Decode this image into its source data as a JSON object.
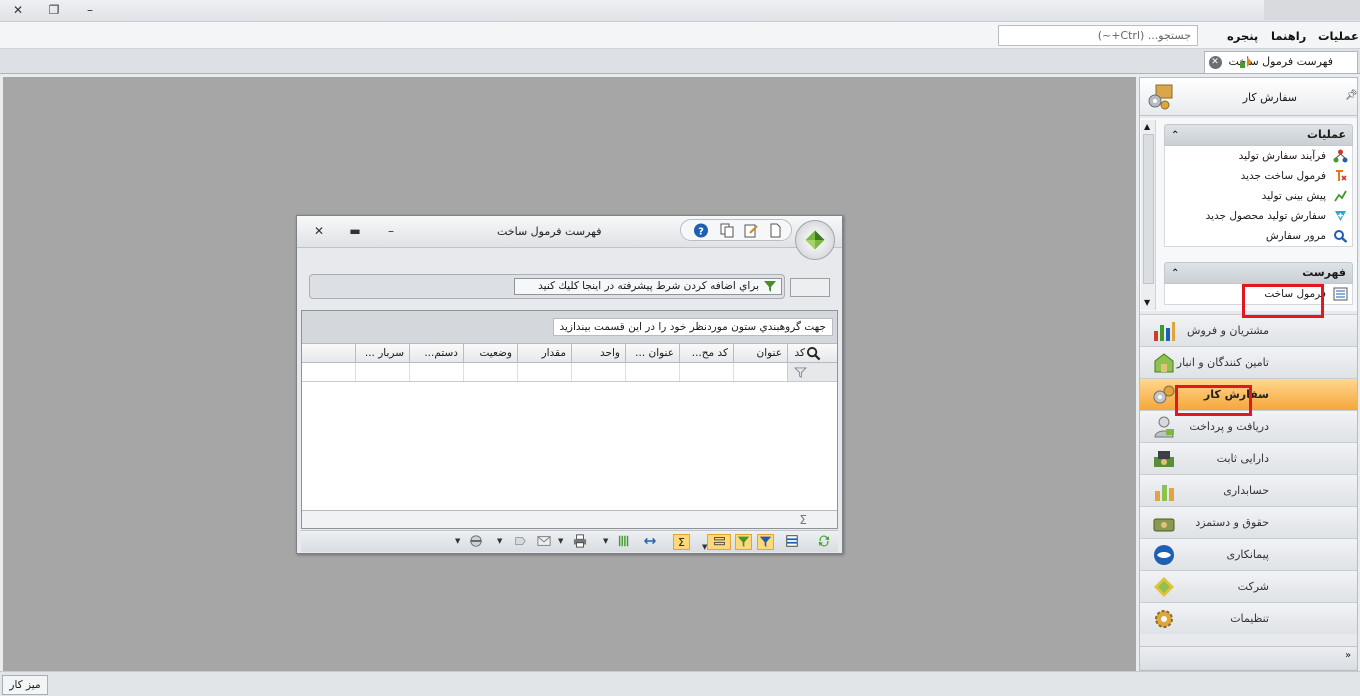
{
  "window_controls": {
    "close": "✕",
    "restore": "❐",
    "minimize": "–"
  },
  "menu": {
    "items": [
      "عملیات",
      "راهنما",
      "پنجره"
    ],
    "search_placeholder": "جستجو... (Ctrl+~)"
  },
  "doc_tab": {
    "label": "فهرست فرمول ساخت"
  },
  "child_window": {
    "title": "فهرست فرمول ساخت",
    "filter_prompt": "براي اضافه كردن شرط پيشرفته در اينجا كليك كنيد",
    "group_prompt": "جهت گروهبندي ستون موردنظر خود را در اين قسمت بيندازيد",
    "columns": [
      "کد",
      "عنوان",
      "کد مح...",
      "عنوان ...",
      "واحد",
      "مقدار",
      "وضعیت",
      "دستم...",
      "سربار ..."
    ],
    "rows": []
  },
  "nav": {
    "header_title": "سفارش کار",
    "groups": [
      {
        "title": "عملیات",
        "items": [
          {
            "label": "فرآیند سفارش تولید",
            "icon": "process-icon"
          },
          {
            "label": "فرمول ساخت جدید",
            "icon": "new-formula-icon"
          },
          {
            "label": "پیش بینی تولید",
            "icon": "forecast-icon"
          },
          {
            "label": "سفارش تولید محصول جدید",
            "icon": "new-order-icon"
          },
          {
            "label": "مرور سفارش",
            "icon": "order-review-icon"
          }
        ]
      },
      {
        "title": "فهرست",
        "items": [
          {
            "label": "فرمول ساخت",
            "icon": "list-icon"
          }
        ]
      }
    ],
    "modules": [
      {
        "label": "مشتریان و فروش",
        "icon": "sales-chart-icon"
      },
      {
        "label": "تامین کنندگان و انبار",
        "icon": "warehouse-icon"
      },
      {
        "label": "سفارش کار",
        "icon": "gears-icon",
        "active": true
      },
      {
        "label": "دریافت و پرداخت",
        "icon": "payment-icon"
      },
      {
        "label": "دارایی ثابت",
        "icon": "asset-icon"
      },
      {
        "label": "حسابداری",
        "icon": "accounting-icon"
      },
      {
        "label": "حقوق و دستمزد",
        "icon": "payroll-icon"
      },
      {
        "label": "پیمانکاری",
        "icon": "contract-icon"
      },
      {
        "label": "شرکت",
        "icon": "company-icon"
      },
      {
        "label": "تنظیمات",
        "icon": "settings-icon"
      }
    ]
  },
  "statusbar": {
    "desk_label": "میز کار"
  },
  "colors": {
    "highlight": "#e2171f",
    "active_module": "#f6a63a",
    "workspace": "#a6a6a6"
  }
}
